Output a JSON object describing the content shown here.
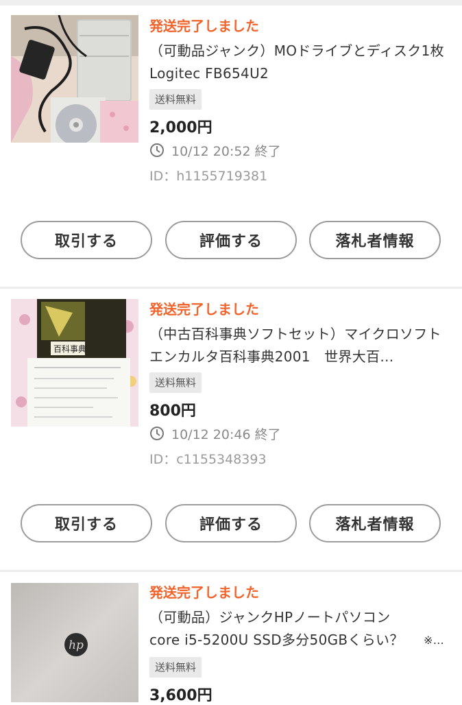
{
  "items": [
    {
      "status": "発送完了しました",
      "title": "（可動品ジャンク）MOドライブとディスク1枚　Logitec FB654U2",
      "badge": "送料無料",
      "price": "2,000円",
      "end_time": "10/12 20:52 終了",
      "id": "ID：h1155719381",
      "thumbnail_icon": "mo-drive-photo",
      "buttons": {
        "trade": "取引する",
        "rate": "評価する",
        "winner": "落札者情報"
      }
    },
    {
      "status": "発送完了しました",
      "title": "（中古百科事典ソフトセット）マイクロソフトエンカルタ百科事典2001　世界大百…",
      "badge": "送料無料",
      "price": "800円",
      "end_time": "10/12 20:46 終了",
      "id": "ID：c1155348393",
      "thumbnail_icon": "encarta-box-photo",
      "thumbnail_text": "百科事典",
      "buttons": {
        "trade": "取引する",
        "rate": "評価する",
        "winner": "落札者情報"
      }
    },
    {
      "status": "発送完了しました",
      "title_line1": "（可動品）ジャンクHPノートパソコン",
      "title_line2": "core i5-5200U SSD多分50GBくらい？",
      "title_line2_tail": "※…",
      "badge": "送料無料",
      "price": "3,600円",
      "thumbnail_icon": "hp-laptop-photo",
      "thumbnail_logo_text": "hp"
    }
  ],
  "colors": {
    "status": "#f0632b",
    "badge_bg": "#e9e9e9",
    "button_border": "#9b9b9b"
  }
}
